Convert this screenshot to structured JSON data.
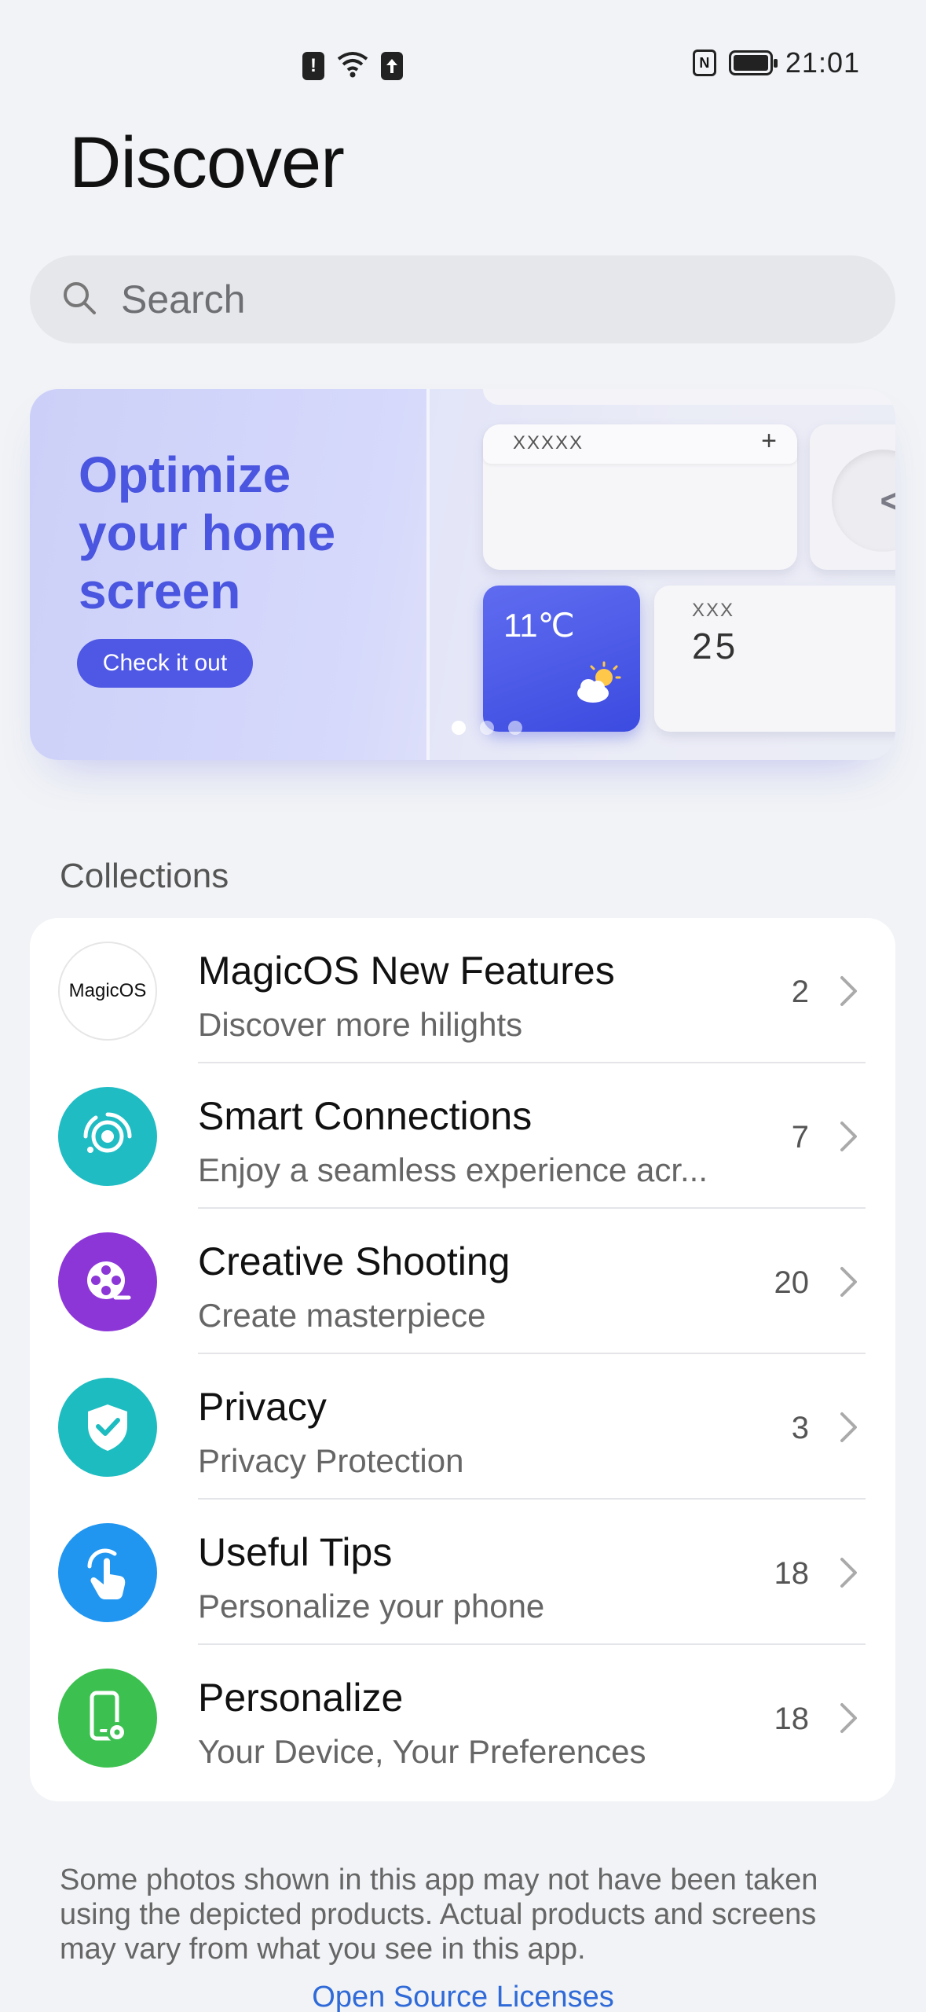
{
  "status_bar": {
    "alert_icon": "alert-icon",
    "time": "21:01",
    "nfc_label": "N"
  },
  "page": {
    "title": "Discover"
  },
  "search": {
    "placeholder": "Search"
  },
  "banner": {
    "headline": "Optimize your home screen",
    "button_label": "Check it out",
    "widget_label": "XXXXX",
    "weather_temp": "11℃",
    "num_label": "XXX",
    "num_value": "25",
    "active_slide": 1,
    "slide_count": 3
  },
  "collections": {
    "label": "Collections",
    "items": [
      {
        "title": "MagicOS New Features",
        "subtitle": "Discover more hilights",
        "count": "2",
        "icon": "magicos-logo",
        "logo_text": "MagicOS"
      },
      {
        "title": "Smart Connections",
        "subtitle": "Enjoy a seamless experience acr...",
        "count": "7",
        "icon": "connection-icon",
        "color": "#1fbcc4"
      },
      {
        "title": "Creative Shooting",
        "subtitle": "Create masterpiece",
        "count": "20",
        "icon": "film-reel-icon",
        "color": "#8d36d8"
      },
      {
        "title": "Privacy",
        "subtitle": "Privacy Protection",
        "count": "3",
        "icon": "shield-check-icon",
        "color": "#1dbcc0"
      },
      {
        "title": "Useful Tips",
        "subtitle": "Personalize your phone",
        "count": "18",
        "icon": "tap-hand-icon",
        "color": "#2196f0"
      },
      {
        "title": "Personalize",
        "subtitle": "Your Device, Your Preferences",
        "count": "18",
        "icon": "phone-gear-icon",
        "color": "#3cc150"
      }
    ]
  },
  "footer": {
    "disclaimer": "Some photos shown in this app may not have been taken using the depicted products. Actual products and screens may vary from what you see in this app.",
    "link": "Open Source Licenses"
  },
  "colors": {
    "accent": "#4f58e4",
    "link": "#2f6ad8",
    "background": "#f1f3f6"
  }
}
